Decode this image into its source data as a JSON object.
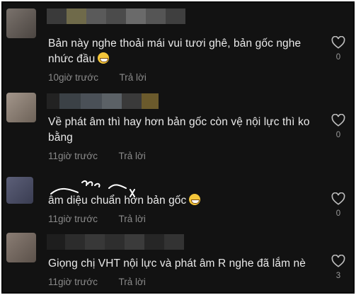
{
  "comments": [
    {
      "text_line1": "Bản này nghe thoải mái vui tươi ghê, bản gốc nghe",
      "text_line2": "nhức đầu",
      "time": "10giờ trước",
      "reply": "Trả lời",
      "likes": "0"
    },
    {
      "text_line1": "Về phát âm thì hay hơn bản gốc còn vệ nội lực thì ko",
      "text_line2": "bằng",
      "time": "11giờ trước",
      "reply": "Trả lời",
      "likes": "0"
    },
    {
      "text_line1": "âm diệu chuẩn hơn bản gốc",
      "time": "11giờ trước",
      "reply": "Trả lời",
      "likes": "0"
    },
    {
      "text_line1": "Giọng chị VHT nội lực và phát âm R nghe đã lắm nè",
      "time": "11giờ trước",
      "reply": "Trả lời",
      "likes": "3"
    }
  ],
  "icons": {
    "like": "heart-outline-icon",
    "emoji": "grinning-face-icon"
  },
  "colors": {
    "background": "#121212",
    "text": "#eaeaea",
    "meta": "#8a8a8a"
  }
}
